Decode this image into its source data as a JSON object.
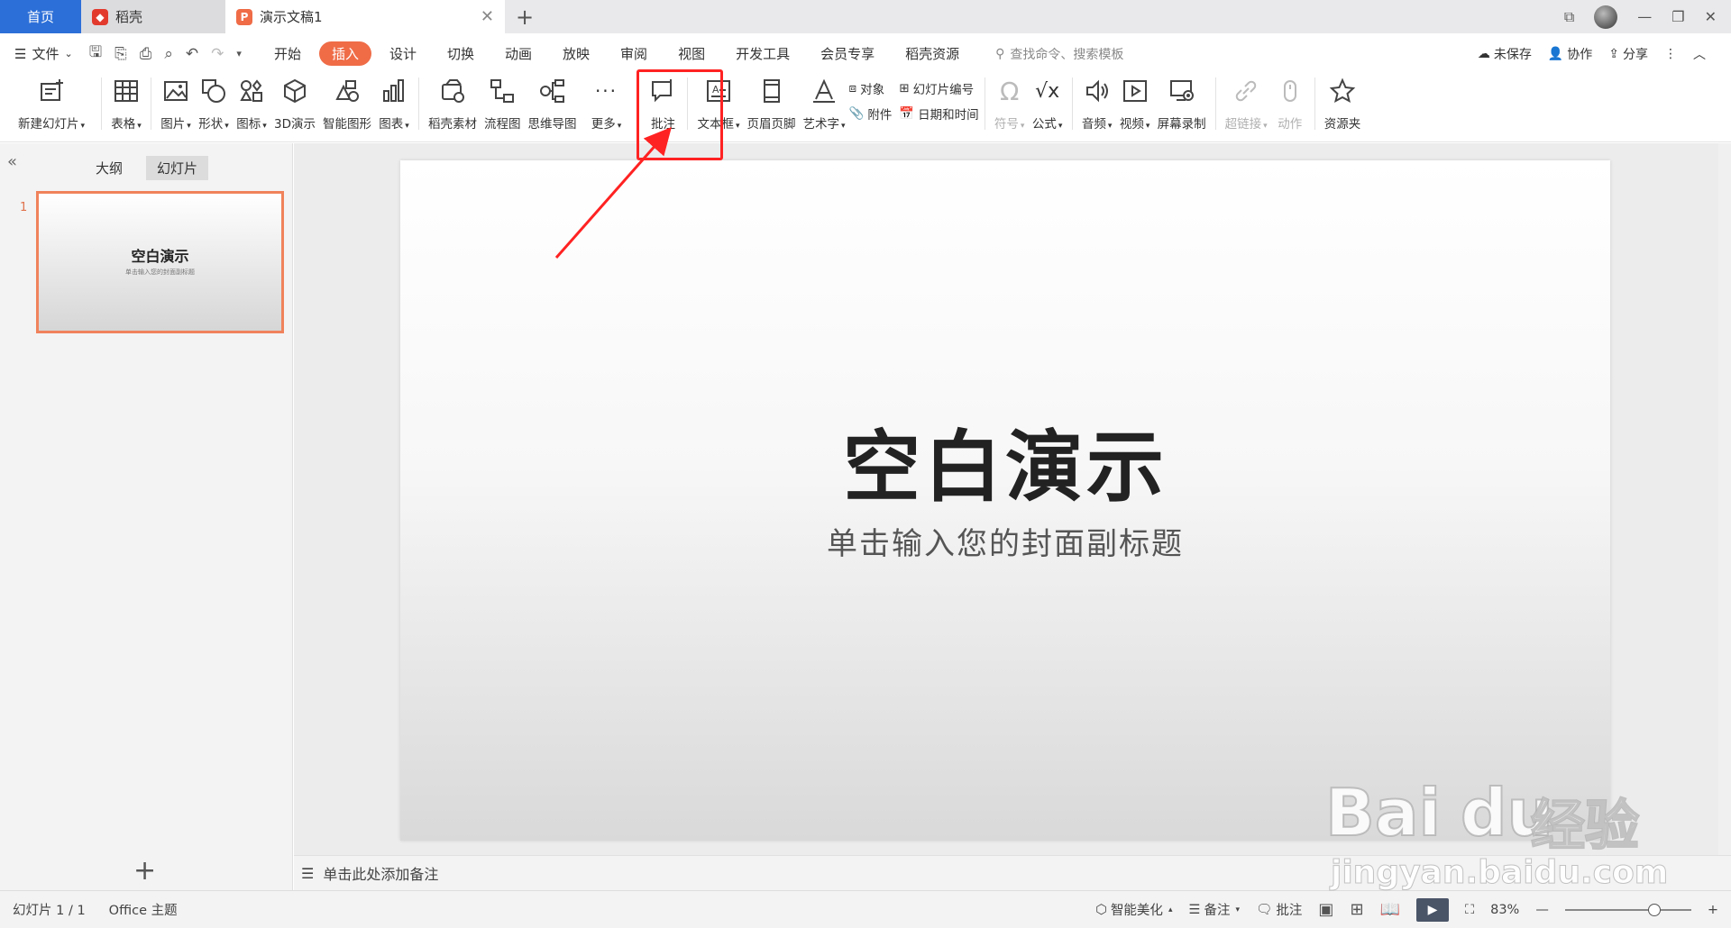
{
  "tabs": {
    "home": "首页",
    "daoke": "稻壳",
    "document": "演示文稿1"
  },
  "menu": {
    "file": "文件",
    "tabs": [
      "开始",
      "插入",
      "设计",
      "切换",
      "动画",
      "放映",
      "审阅",
      "视图",
      "开发工具",
      "会员专享",
      "稻壳资源"
    ],
    "active_tab": "插入",
    "search_placeholder": "查找命令、搜索模板",
    "unsaved": "未保存",
    "collaborate": "协作",
    "share": "分享"
  },
  "ribbon": {
    "new_slide": "新建幻灯片",
    "table": "表格",
    "picture": "图片",
    "shape": "形状",
    "icon": "图标",
    "three_d": "3D演示",
    "smart_art": "智能图形",
    "chart": "图表",
    "daoke_material": "稻壳素材",
    "flowchart": "流程图",
    "mindmap": "思维导图",
    "more": "更多",
    "comment": "批注",
    "textbox": "文本框",
    "header_footer": "页眉页脚",
    "wordart": "艺术字",
    "object": "对象",
    "attachment": "附件",
    "slide_number": "幻灯片编号",
    "datetime": "日期和时间",
    "symbol": "符号",
    "formula": "公式",
    "audio": "音频",
    "video": "视频",
    "screen_record": "屏幕录制",
    "hyperlink": "超链接",
    "action": "动作",
    "resource": "资源夹"
  },
  "left_panel": {
    "tab_outline": "大纲",
    "tab_slides": "幻灯片",
    "slide_number": "1",
    "thumb_title": "空白演示",
    "thumb_subtitle": "单击输入您的封面副标题"
  },
  "slide": {
    "title": "空白演示",
    "subtitle": "单击输入您的封面副标题"
  },
  "notes_placeholder": "单击此处添加备注",
  "status": {
    "slide_count": "幻灯片 1 / 1",
    "theme": "Office 主题",
    "beautify": "智能美化",
    "notes": "备注",
    "comments": "批注",
    "zoom": "83%",
    "zoom_fraction": 0.66
  },
  "watermark": {
    "brand": "Bai",
    "brand2": "du",
    "cn": "经验",
    "url": "jingyan.baidu.com"
  },
  "colors": {
    "accent": "#ef6c47",
    "home_tab": "#2c6fd8",
    "highlight": "#ff2222"
  }
}
